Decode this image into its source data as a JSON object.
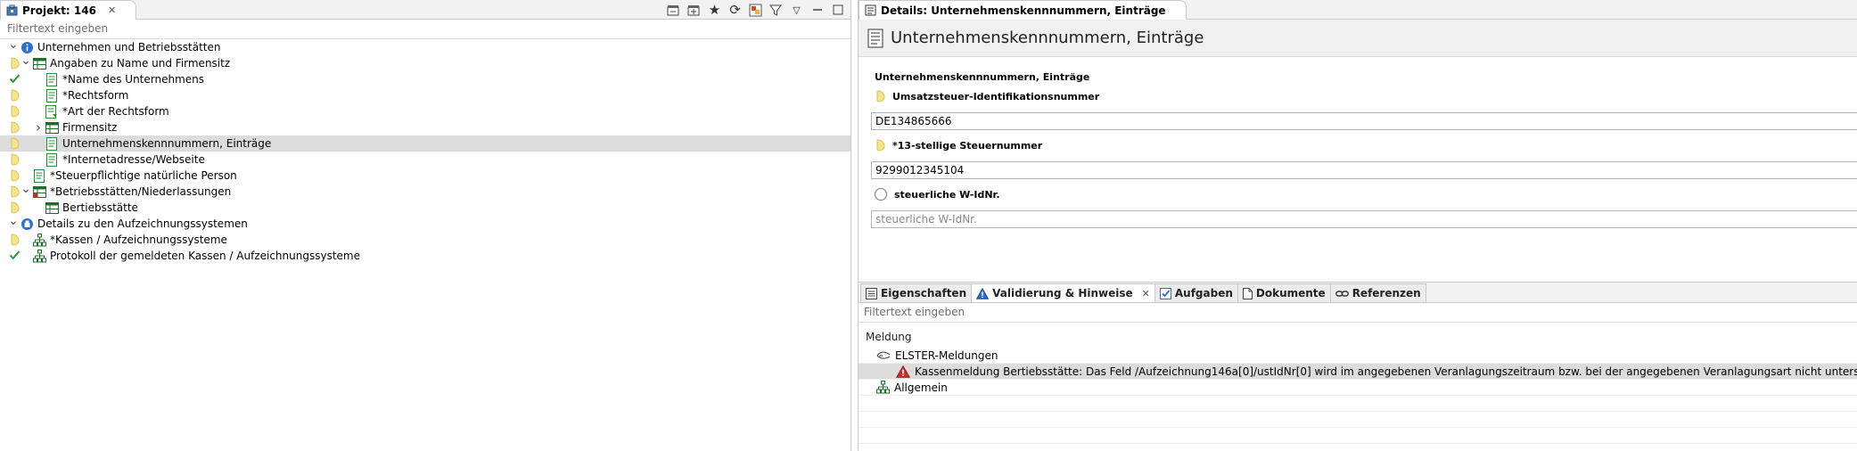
{
  "left_panel": {
    "tab_title": "Projekt: 146",
    "filter_placeholder": "Filtertext eingeben",
    "tree": [
      {
        "label": "Unternehmen und Betriebsstätten",
        "level": 0,
        "twisty": "expanded",
        "icon": "info-icon",
        "status": ""
      },
      {
        "label": "Angaben zu Name und Firmensitz",
        "level": 1,
        "twisty": "expanded",
        "icon": "table-icon",
        "status": "pending"
      },
      {
        "label": "*Name des Unternehmens",
        "level": 2,
        "twisty": "",
        "icon": "form-page-icon",
        "status": "done"
      },
      {
        "label": "*Rechtsform",
        "level": 2,
        "twisty": "",
        "icon": "form-page-icon",
        "status": "pending"
      },
      {
        "label": "*Art der Rechtsform",
        "level": 2,
        "twisty": "",
        "icon": "form-list-icon",
        "status": "pending"
      },
      {
        "label": "Firmensitz",
        "level": 2,
        "twisty": "collapsed",
        "icon": "table-icon",
        "status": "pending"
      },
      {
        "label": "Unternehmenskennnummern, Einträge",
        "level": 2,
        "twisty": "",
        "icon": "form-page-icon",
        "status": "pending",
        "selected": true
      },
      {
        "label": "*Internetadresse/Webseite",
        "level": 2,
        "twisty": "",
        "icon": "form-page-icon",
        "status": "pending"
      },
      {
        "label": "*Steuerpflichtige natürliche Person",
        "level": 1,
        "twisty": "",
        "icon": "form-page-icon",
        "status": "pending"
      },
      {
        "label": "*Betriebsstätten/Niederlassungen",
        "level": 1,
        "twisty": "expanded",
        "icon": "table-red-icon",
        "status": "pending"
      },
      {
        "label": "Bertiebsstätte",
        "level": 2,
        "twisty": "",
        "icon": "table-icon",
        "status": "pending"
      },
      {
        "label": "Details zu den Aufzeichnungssystemen",
        "level": 0,
        "twisty": "expanded",
        "icon": "register-icon",
        "status": ""
      },
      {
        "label": "*Kassen / Aufzeichnungssysteme",
        "level": 1,
        "twisty": "",
        "icon": "hierarchy-icon",
        "status": "pending"
      },
      {
        "label": "Protokoll der gemeldeten Kassen / Aufzeichnungssysteme",
        "level": 1,
        "twisty": "",
        "icon": "hierarchy-icon",
        "status": "done"
      }
    ]
  },
  "right_panel": {
    "tab_title": "Details: Unternehmenskennnummern, Einträge",
    "editor_title": "Unternehmenskennnummern, Einträge",
    "section_title": "Unternehmenskennnummern, Einträge",
    "fields": [
      {
        "label": "Umsatzsteuer-Identifikationsnummer",
        "value": "DE134865666",
        "placeholder": "",
        "status": "pending"
      },
      {
        "label": "*13-stellige Steuernummer",
        "value": "9299012345104",
        "placeholder": "",
        "status": "pending"
      },
      {
        "label": "steuerliche W-IdNr.",
        "value": "",
        "placeholder": "steuerliche W-IdNr.",
        "status": "empty"
      }
    ],
    "bottom_tabs": [
      {
        "label": "Eigenschaften",
        "icon": "properties-icon",
        "active": false,
        "closable": false
      },
      {
        "label": "Validierung & Hinweise",
        "icon": "warning-icon",
        "active": true,
        "closable": true
      },
      {
        "label": "Aufgaben",
        "icon": "tasks-icon",
        "active": false,
        "closable": false
      },
      {
        "label": "Dokumente",
        "icon": "document-icon",
        "active": false,
        "closable": false
      },
      {
        "label": "Referenzen",
        "icon": "link-icon",
        "active": false,
        "closable": false
      }
    ],
    "bottom_filter_placeholder": "Filtertext eingeben",
    "messages_header": "Meldung",
    "messages": [
      {
        "text": "ELSTER-Meldungen",
        "level": 0,
        "icon": "elster-icon",
        "twisty": "expanded"
      },
      {
        "text": "Kassenmeldung Bertiebsstätte: Das Feld /Aufzeichnung146a[0]/ustIdNr[0] wird im angegebenen Veranlagungszeitraum bzw. bei der angegebenen Veranlagungsart nicht unterstützt.",
        "level": 1,
        "icon": "error-triangle-icon",
        "twisty": "",
        "selected": true
      },
      {
        "text": "Allgemein",
        "level": 0,
        "icon": "hierarchy-icon",
        "twisty": ""
      }
    ]
  },
  "colors": {
    "pending": "#f3e58c",
    "done": "#2a9a3a",
    "error": "#d42a2a",
    "info": "#2a6fd1",
    "selection": "#dcdcdc"
  }
}
